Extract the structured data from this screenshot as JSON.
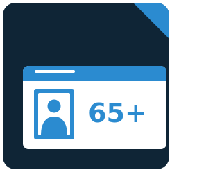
{
  "badge": {
    "text": "65+"
  },
  "icons": {
    "person": "person-silhouette-icon"
  },
  "colors": {
    "background": "#0f2536",
    "accent": "#2b8bd0",
    "card": "#ffffff"
  }
}
